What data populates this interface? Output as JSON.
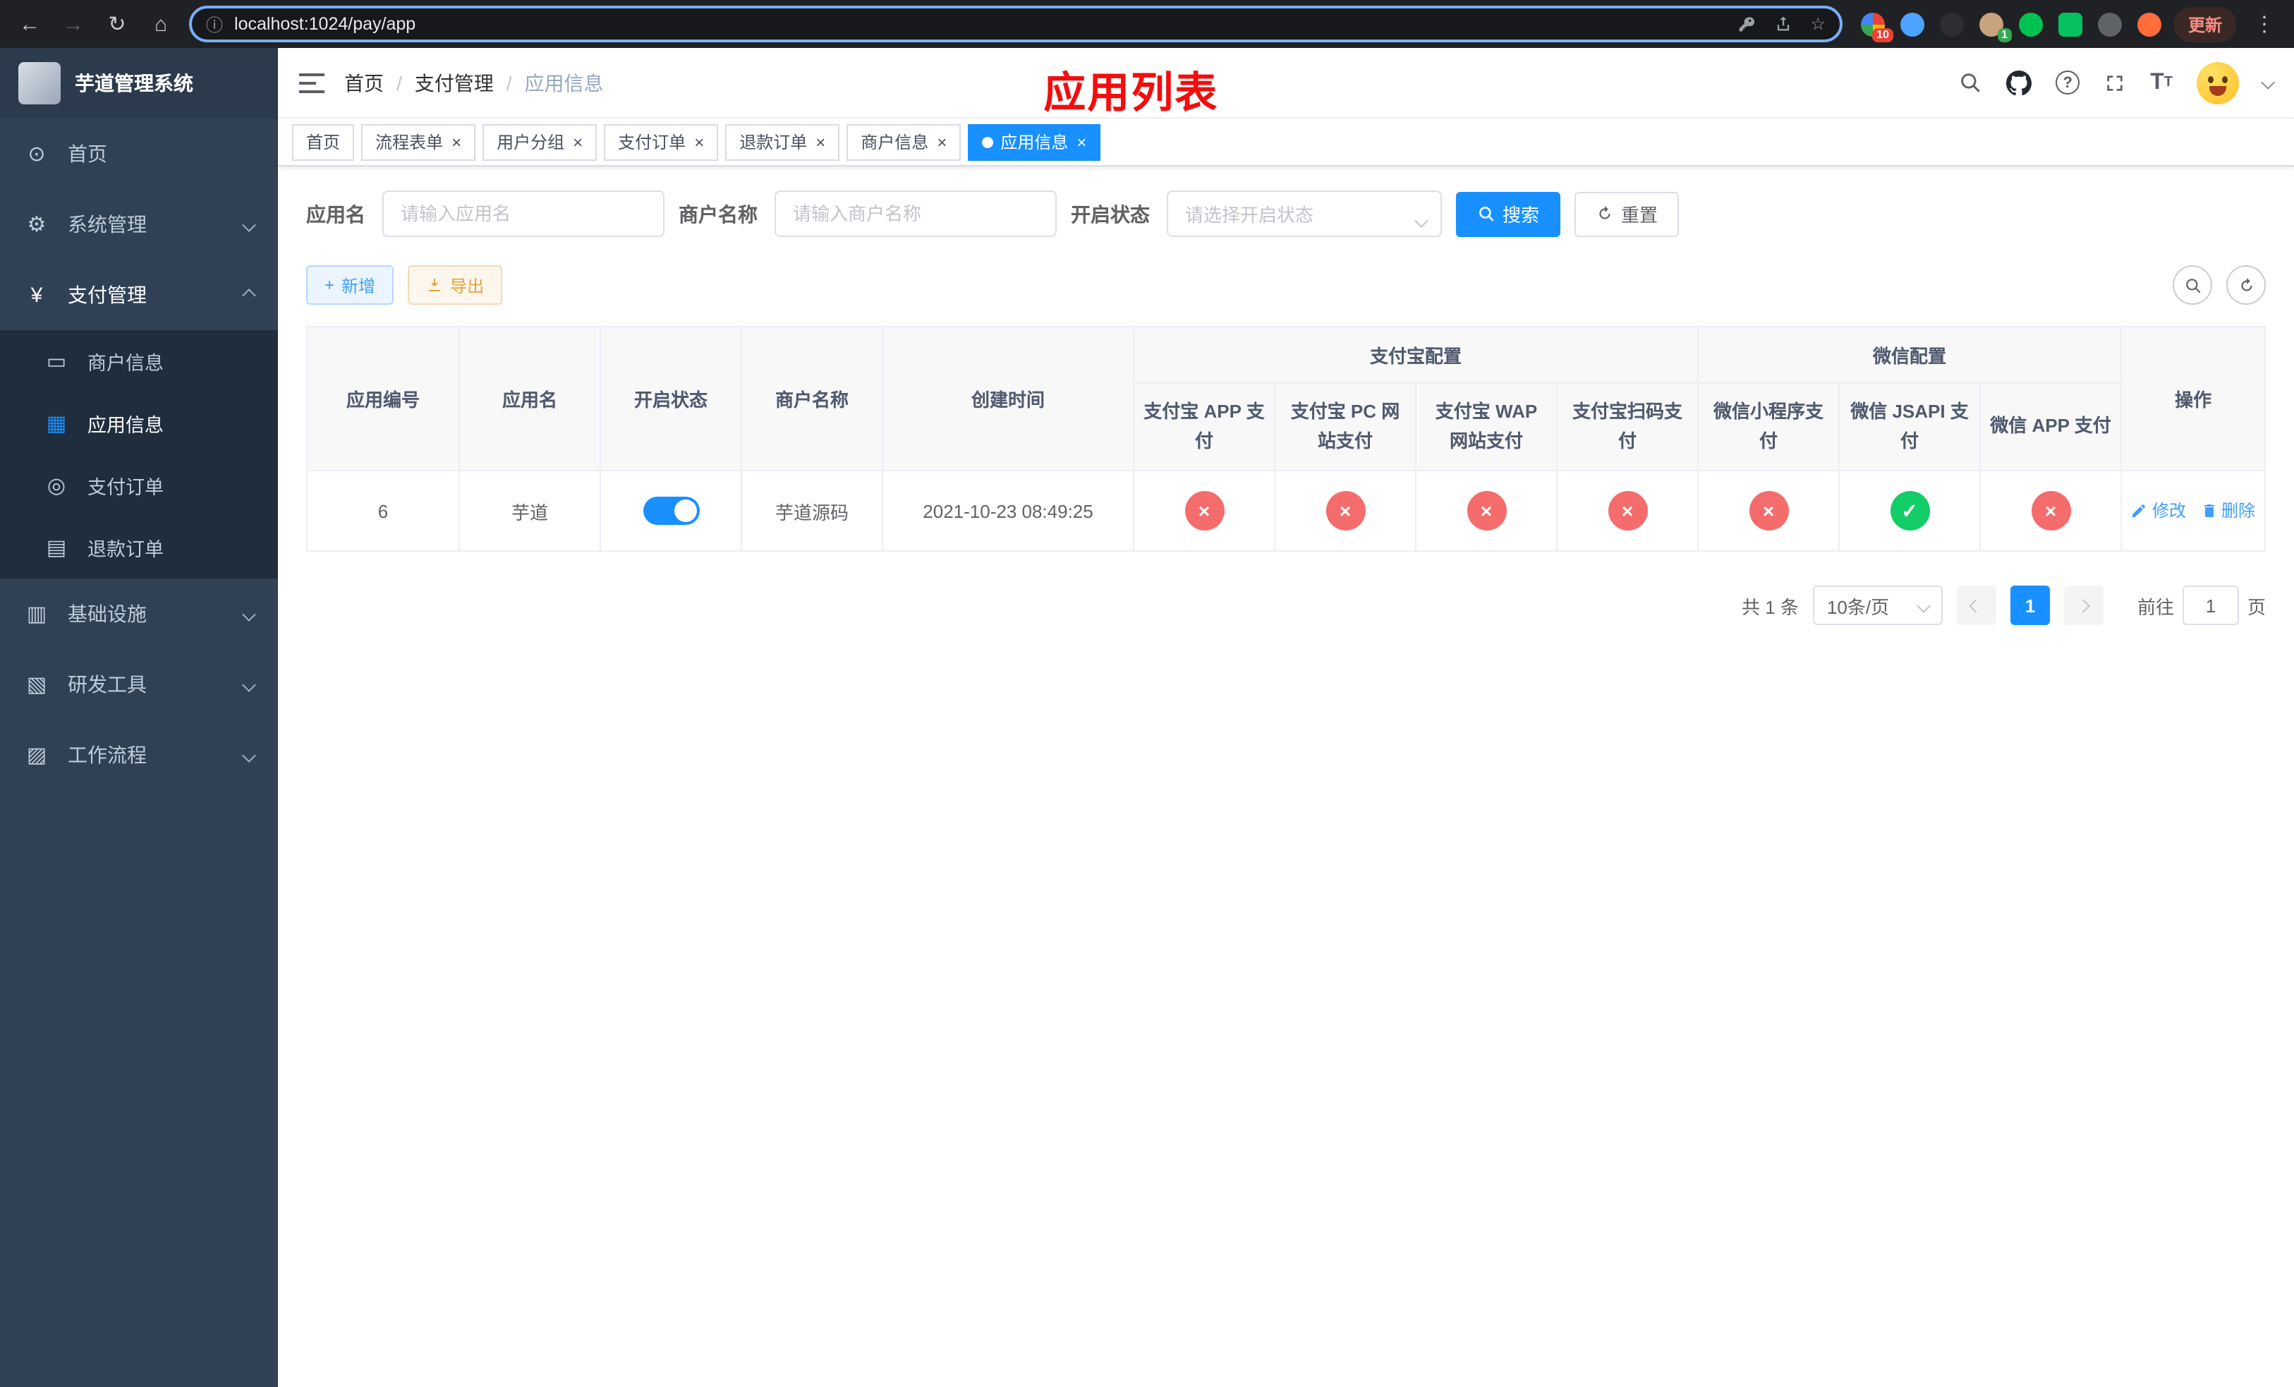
{
  "colors": {
    "primary": "#1890ff",
    "success": "#13ce66",
    "danger": "#f56c6c",
    "warning": "#e6a23c",
    "annotation_red": "#f30d0d",
    "tab_active": "#1890ff"
  },
  "icons": {
    "back": "←",
    "forward": "→",
    "reload": "↻",
    "home": "⌂",
    "info": "ⓘ",
    "star": "☆",
    "menu_dots": "⋮",
    "close": "×",
    "check": "✓",
    "cross": "×",
    "plus": "+",
    "question": "?",
    "dashboard": "⊙",
    "system": "⚙",
    "payment": "¥",
    "merchant": "▭",
    "app": "▦",
    "order": "◎",
    "refund": "▤",
    "infra": "▥",
    "devtool": "▧",
    "workflow": "▨"
  },
  "browser": {
    "url": "localhost:1024/pay/app",
    "update_label": "更新",
    "extensions": [
      {
        "name": "extension-1",
        "color": "#8ab4f8",
        "badge": "10",
        "badge_color": "#e94235",
        "multi": true
      },
      {
        "name": "extension-2",
        "color": "#4da3ff"
      },
      {
        "name": "extension-3",
        "color": "#2d2e31"
      },
      {
        "name": "extension-4",
        "color": "#c9a27e",
        "badge": "1",
        "badge_color": "#34a853"
      },
      {
        "name": "extension-5",
        "color": "#00c250"
      },
      {
        "name": "extension-6",
        "color": "#07c160",
        "shape": "square"
      },
      {
        "name": "extension-7",
        "color": "#5f6368"
      },
      {
        "name": "extension-8",
        "color": "#ff6d3b"
      }
    ]
  },
  "annotation": "应用列表",
  "sidebar": {
    "title": "芋道管理系统",
    "menu": [
      {
        "key": "home",
        "icon": "dashboard",
        "label": "首页",
        "type": "top"
      },
      {
        "key": "system",
        "icon": "system",
        "label": "系统管理",
        "type": "top",
        "arrow": "down"
      },
      {
        "key": "payment",
        "icon": "payment",
        "label": "支付管理",
        "type": "top",
        "arrow": "up",
        "active": true
      },
      {
        "key": "merchant-info",
        "icon": "merchant",
        "label": "商户信息",
        "type": "sub"
      },
      {
        "key": "app-info",
        "icon": "app",
        "label": "应用信息",
        "type": "sub",
        "active": true
      },
      {
        "key": "pay-order",
        "icon": "order",
        "label": "支付订单",
        "type": "sub"
      },
      {
        "key": "refund-order",
        "icon": "refund",
        "label": "退款订单",
        "type": "sub"
      },
      {
        "key": "infrastructure",
        "icon": "infra",
        "label": "基础设施",
        "type": "top",
        "arrow": "down"
      },
      {
        "key": "dev-tools",
        "icon": "devtool",
        "label": "研发工具",
        "type": "top",
        "arrow": "down"
      },
      {
        "key": "workflow",
        "icon": "workflow",
        "label": "工作流程",
        "type": "top",
        "arrow": "down"
      }
    ]
  },
  "breadcrumb": [
    "首页",
    "支付管理",
    "应用信息"
  ],
  "tabs": [
    {
      "label": "首页",
      "closable": false
    },
    {
      "label": "流程表单",
      "closable": true
    },
    {
      "label": "用户分组",
      "closable": true
    },
    {
      "label": "支付订单",
      "closable": true
    },
    {
      "label": "退款订单",
      "closable": true
    },
    {
      "label": "商户信息",
      "closable": true
    },
    {
      "label": "应用信息",
      "closable": true,
      "active": true
    }
  ],
  "filters": {
    "app_name_label": "应用名",
    "app_name_placeholder": "请输入应用名",
    "merchant_label": "商户名称",
    "merchant_placeholder": "请输入商户名称",
    "status_label": "开启状态",
    "status_placeholder": "请选择开启状态",
    "search_label": "搜索",
    "reset_label": "重置"
  },
  "toolbar": {
    "add_label": "新增",
    "export_label": "导出"
  },
  "table": {
    "columns_left": [
      "应用编号",
      "应用名",
      "开启状态",
      "商户名称",
      "创建时间"
    ],
    "groups": [
      {
        "label": "支付宝配置",
        "columns": [
          "支付宝 APP 支付",
          "支付宝 PC 网站支付",
          "支付宝 WAP 网站支付",
          "支付宝扫码支付"
        ]
      },
      {
        "label": "微信配置",
        "columns": [
          "微信小程序支付",
          "微信 JSAPI 支付",
          "微信 APP 支付"
        ]
      }
    ],
    "column_op": "操作",
    "rows": [
      {
        "id": "6",
        "name": "芋道",
        "enabled": true,
        "merchant": "芋道源码",
        "created": "2021-10-23 08:49:25",
        "channels": [
          false,
          false,
          false,
          false,
          false,
          true,
          false
        ],
        "edit_label": "修改",
        "delete_label": "删除"
      }
    ]
  },
  "pagination": {
    "total_text": "共 1 条",
    "page_size": "10条/页",
    "current_page": "1",
    "goto_prefix": "前往",
    "goto_value": "1",
    "goto_suffix": "页"
  }
}
